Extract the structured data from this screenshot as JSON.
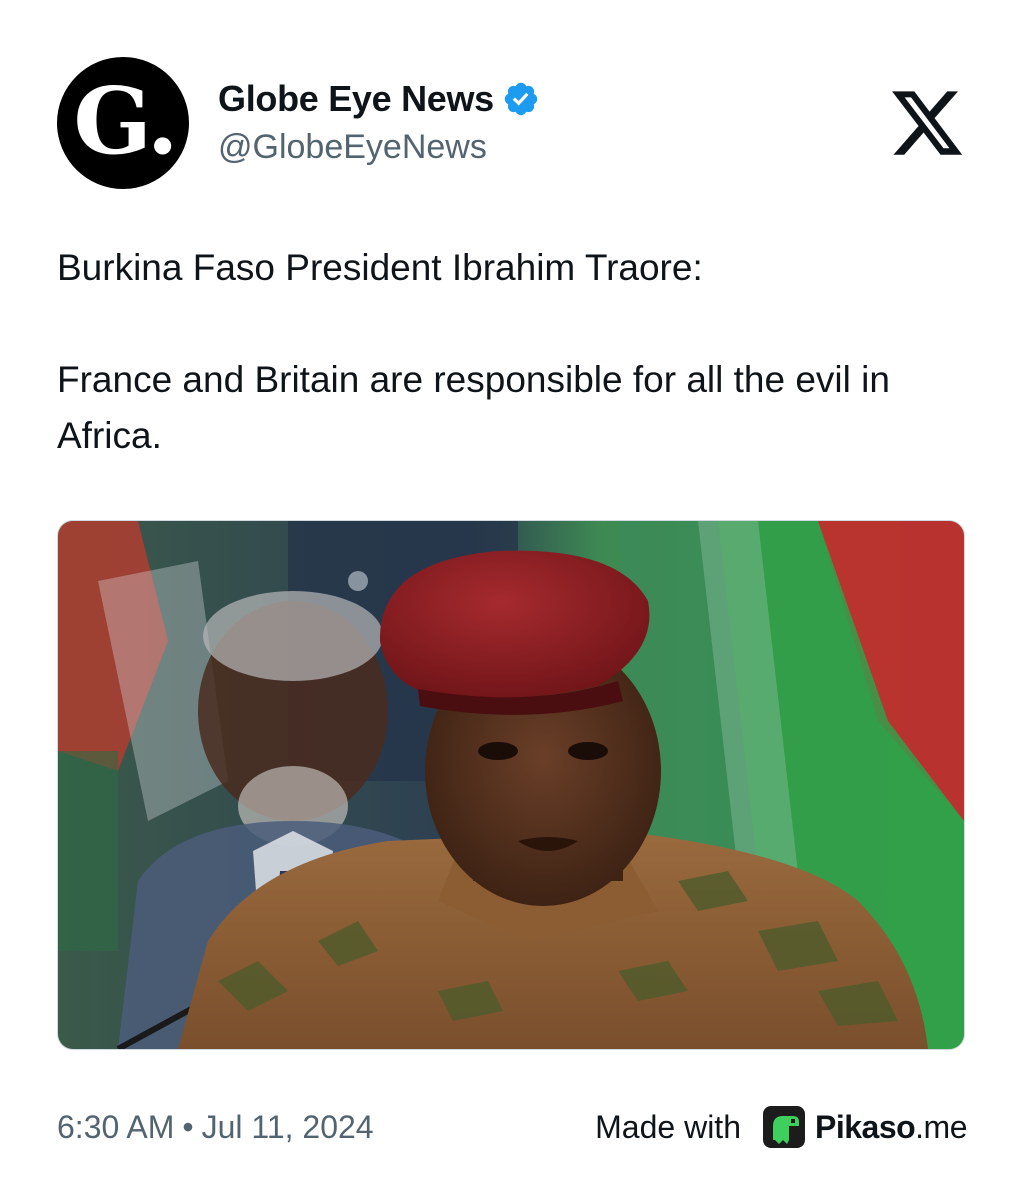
{
  "account": {
    "avatar_letter": "G.",
    "display_name": "Globe Eye News",
    "handle": "@GlobeEyeNews",
    "verified_icon": "verified-badge-icon",
    "verified_color": "#1d9bf0"
  },
  "platform_icon": "x-logo-icon",
  "tweet": {
    "line1": "Burkina Faso President Ibrahim Traore:",
    "line2": "France and Britain are responsible for all the evil in Africa."
  },
  "media": {
    "image": "photo-of-speaker-in-red-beret-at-microphone"
  },
  "footer": {
    "time": "6:30 AM",
    "separator": "•",
    "date": "Jul 11, 2024",
    "made_with": "Made with",
    "brand_name": "Pikaso",
    "brand_tld": ".me",
    "brand_icon": "pikaso-dino-icon"
  },
  "colors": {
    "text_primary": "#0f1419",
    "text_secondary": "#536471",
    "accent": "#1d9bf0"
  }
}
